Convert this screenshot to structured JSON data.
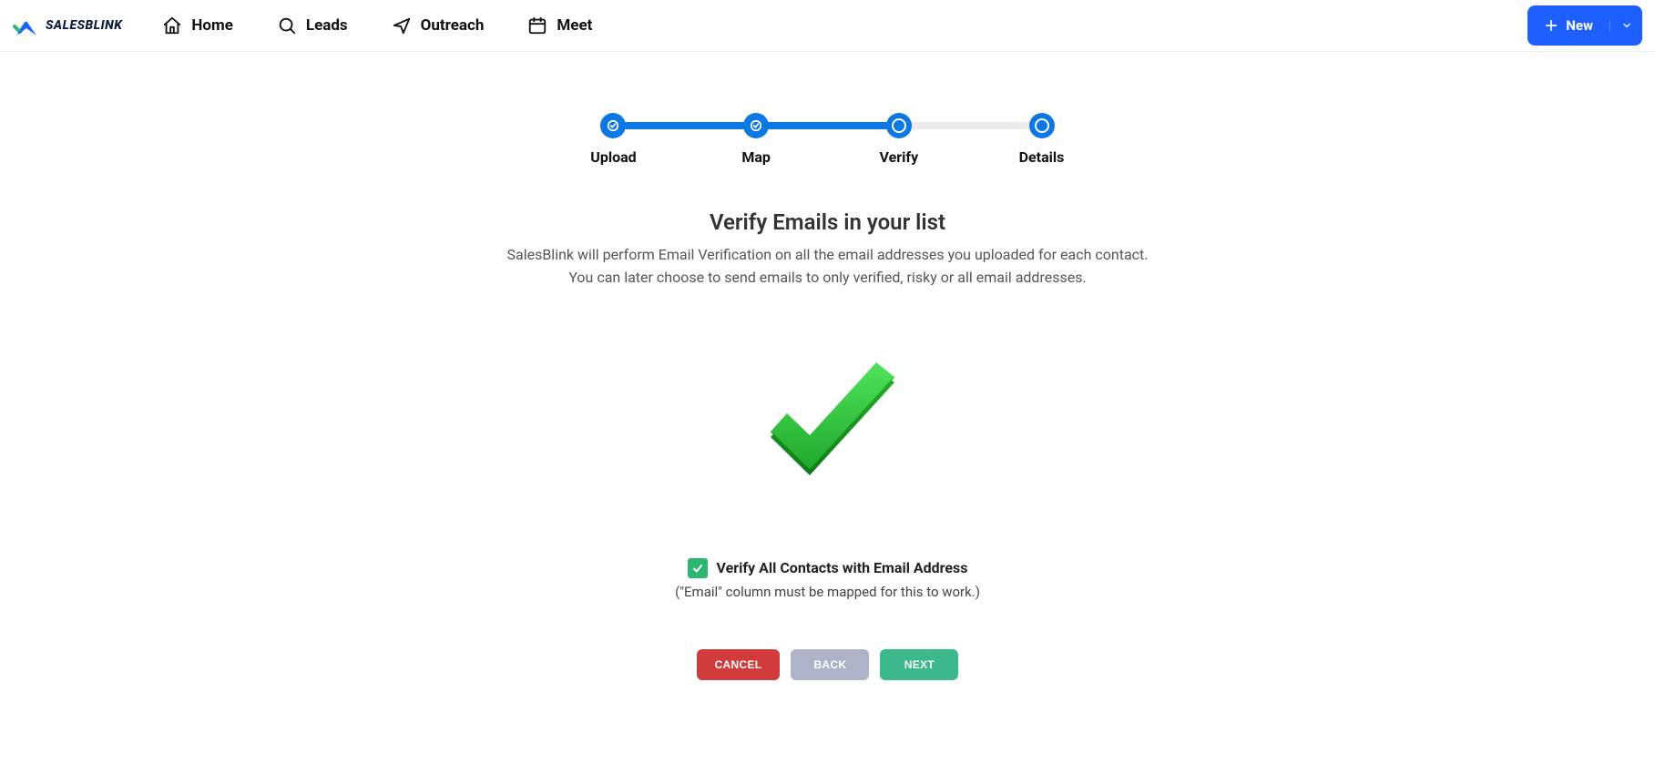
{
  "brand": {
    "name": "SALESBLINK"
  },
  "nav": {
    "home": "Home",
    "leads": "Leads",
    "outreach": "Outreach",
    "meet": "Meet"
  },
  "header": {
    "new_label": "New"
  },
  "stepper": {
    "steps": [
      "Upload",
      "Map",
      "Verify",
      "Details"
    ]
  },
  "page": {
    "title": "Verify Emails in your list",
    "desc_line1": "SalesBlink will perform Email Verification on all the email addresses you uploaded for each contact.",
    "desc_line2": "You can later choose to send emails to only verified, risky or all email addresses."
  },
  "verify": {
    "checkbox_label": "Verify All Contacts with Email Address",
    "hint": "(\"Email\" column must be mapped for this to work.)",
    "checked": true
  },
  "actions": {
    "cancel": "CANCEL",
    "back": "BACK",
    "next": "NEXT"
  }
}
